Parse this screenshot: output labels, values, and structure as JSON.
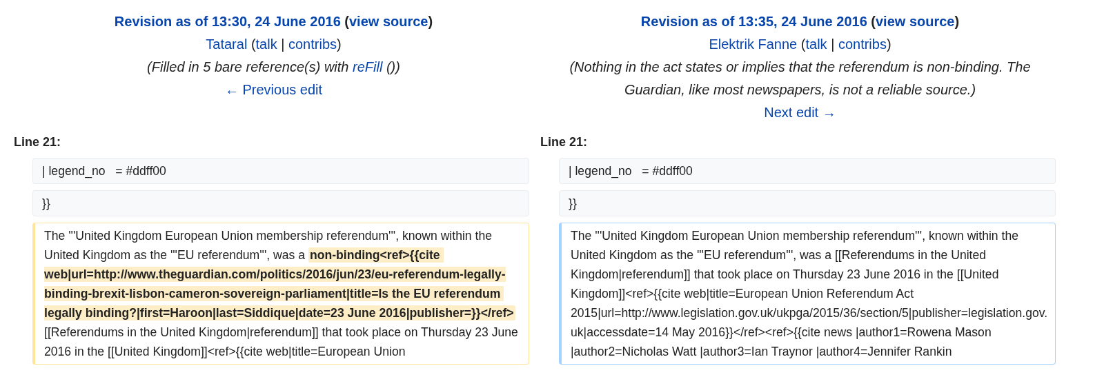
{
  "columns": [
    {
      "header": {
        "title_line": [
          {
            "text": "Revision as of 13:30, 24 June 2016",
            "link": true
          },
          {
            "text": " (",
            "link": false
          },
          {
            "text": "view source",
            "link": true
          },
          {
            "text": ")",
            "link": false
          }
        ],
        "user_line": [
          {
            "text": "Tataral",
            "link": true
          },
          {
            "text": " (",
            "link": false
          },
          {
            "text": "talk",
            "link": true
          },
          {
            "text": " | ",
            "link": false
          },
          {
            "text": "contribs",
            "link": true
          },
          {
            "text": ")",
            "link": false
          }
        ],
        "summary": [
          {
            "text": "(Filled in 5 bare reference(s) with ",
            "link": false
          },
          {
            "text": "reFill",
            "link": true
          },
          {
            "text": " ())",
            "link": false
          }
        ],
        "nav_link": "← Previous edit"
      },
      "line_label": "Line 21:",
      "lines": [
        {
          "kind": "context",
          "text": "| legend_no   = #ddff00"
        },
        {
          "kind": "context",
          "text": "}}"
        },
        {
          "kind": "deleted",
          "segments": [
            {
              "text": "The '''United Kingdom European Union membership referendum''', known within the United Kingdom as the '''EU referendum''', was a ",
              "changed": false
            },
            {
              "text": "non-binding<ref>{{cite web|url=http://www.theguardian.com/politics/2016/jun/23/eu-referendum-legally-binding-brexit-lisbon-cameron-sovereign-parliament|title=Is the EU referendum legally binding?|first=Haroon|last=Siddique|date=23 June 2016|publisher=}}</ref>",
              "changed": true
            },
            {
              "text": " [[Referendums in the United Kingdom|referendum]] that took place on Thursday 23 June 2016 in the [[United Kingdom]]<ref>{{cite web|title=European Union",
              "changed": false
            }
          ]
        }
      ]
    },
    {
      "header": {
        "title_line": [
          {
            "text": "Revision as of 13:35, 24 June 2016",
            "link": true
          },
          {
            "text": " (",
            "link": false
          },
          {
            "text": "view source",
            "link": true
          },
          {
            "text": ")",
            "link": false
          }
        ],
        "user_line": [
          {
            "text": "Elektrik Fanne",
            "link": true
          },
          {
            "text": " (",
            "link": false
          },
          {
            "text": "talk",
            "link": true
          },
          {
            "text": " | ",
            "link": false
          },
          {
            "text": "contribs",
            "link": true
          },
          {
            "text": ")",
            "link": false
          }
        ],
        "summary": [
          {
            "text": "(Nothing in the act states or implies that the referendum is non-binding. The Guardian, like most newspapers, is not a reliable source.)",
            "link": false
          }
        ],
        "nav_link": "Next edit →"
      },
      "line_label": "Line 21:",
      "lines": [
        {
          "kind": "context",
          "text": "| legend_no   = #ddff00"
        },
        {
          "kind": "context",
          "text": "}}"
        },
        {
          "kind": "added",
          "segments": [
            {
              "text": "The '''United Kingdom European Union membership referendum''', known within the United Kingdom as the '''EU referendum''', was a [[Referendums in the United Kingdom|referendum]] that took place on Thursday 23 June 2016 in the [[United Kingdom]]<ref>{{cite web|title=European Union Referendum Act 2015|url=http://www.legislation.gov.uk/ukpga/2015/36/section/5|publisher=legislation.gov.uk|accessdate=14 May 2016}}</ref><ref>{{cite news |author1=Rowena Mason |author2=Nicholas Watt |author3=Ian Traynor |author4=Jennifer Rankin",
              "changed": false
            }
          ]
        }
      ]
    }
  ]
}
